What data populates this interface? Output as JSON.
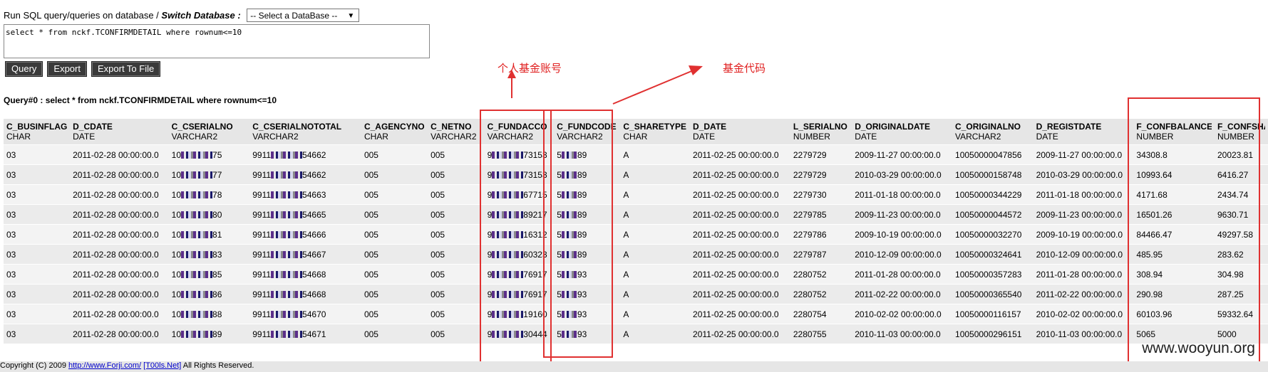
{
  "header": {
    "run_label": "Run SQL query/queries on database /",
    "switch_label": "Switch Database :",
    "db_select_value": "-- Select a DataBase --"
  },
  "sql_text": "select * from nckf.TCONFIRMDETAIL where rownum<=10",
  "buttons": {
    "query": "Query",
    "export": "Export",
    "export_file": "Export To File"
  },
  "query_title": "Query#0 : select * from nckf.TCONFIRMDETAIL where rownum<=10",
  "annotations": {
    "personal_account": "个人基金账号",
    "fund_code": "基金代码"
  },
  "columns": [
    {
      "name": "C_BUSINFLAG",
      "type": "CHAR"
    },
    {
      "name": "D_CDATE",
      "type": "DATE"
    },
    {
      "name": "C_CSERIALNO",
      "type": "VARCHAR2"
    },
    {
      "name": "C_CSERIALNOTOTAL",
      "type": "VARCHAR2"
    },
    {
      "name": "C_AGENCYNO",
      "type": "CHAR"
    },
    {
      "name": "C_NETNO",
      "type": "VARCHAR2"
    },
    {
      "name": "C_FUNDACCO",
      "type": "VARCHAR2"
    },
    {
      "name": "C_FUNDCODE",
      "type": "VARCHAR2"
    },
    {
      "name": "C_SHARETYPE",
      "type": "CHAR"
    },
    {
      "name": "D_DATE",
      "type": "DATE"
    },
    {
      "name": "L_SERIALNO",
      "type": "NUMBER"
    },
    {
      "name": "D_ORIGINALDATE",
      "type": "DATE"
    },
    {
      "name": "C_ORIGINALNO",
      "type": "VARCHAR2"
    },
    {
      "name": "D_REGISTDATE",
      "type": "DATE"
    },
    {
      "name": "F_CONFBALANCE",
      "type": "NUMBER"
    },
    {
      "name": "F_CONFSHAR",
      "type": "NUMBER"
    }
  ],
  "rows": [
    [
      "03",
      "2011-02-28 00:00:00.0",
      "10|75",
      "9911|54662",
      "005",
      "005",
      "9|73153",
      "5|89",
      "A",
      "2011-02-25 00:00:00.0",
      "2279729",
      "2009-11-27 00:00:00.0",
      "10050000047856",
      "2009-11-27 00:00:00.0",
      "34308.8",
      "20023.81"
    ],
    [
      "03",
      "2011-02-28 00:00:00.0",
      "10|77",
      "9911|54662",
      "005",
      "005",
      "9|73153",
      "5|89",
      "A",
      "2011-02-25 00:00:00.0",
      "2279729",
      "2010-03-29 00:00:00.0",
      "10050000158748",
      "2010-03-29 00:00:00.0",
      "10993.64",
      "6416.27"
    ],
    [
      "03",
      "2011-02-28 00:00:00.0",
      "10|78",
      "9911|54663",
      "005",
      "005",
      "9|67715",
      "5|89",
      "A",
      "2011-02-25 00:00:00.0",
      "2279730",
      "2011-01-18 00:00:00.0",
      "10050000344229",
      "2011-01-18 00:00:00.0",
      "4171.68",
      "2434.74"
    ],
    [
      "03",
      "2011-02-28 00:00:00.0",
      "10|80",
      "9911|54665",
      "005",
      "005",
      "9|89217",
      "5|89",
      "A",
      "2011-02-25 00:00:00.0",
      "2279785",
      "2009-11-23 00:00:00.0",
      "10050000044572",
      "2009-11-23 00:00:00.0",
      "16501.26",
      "9630.71"
    ],
    [
      "03",
      "2011-02-28 00:00:00.0",
      "10|81",
      "9911|54666",
      "005",
      "005",
      "9|16312",
      "5|89",
      "A",
      "2011-02-25 00:00:00.0",
      "2279786",
      "2009-10-19 00:00:00.0",
      "10050000032270",
      "2009-10-19 00:00:00.0",
      "84466.47",
      "49297.58"
    ],
    [
      "03",
      "2011-02-28 00:00:00.0",
      "10|83",
      "9911|54667",
      "005",
      "005",
      "9|60323",
      "5|89",
      "A",
      "2011-02-25 00:00:00.0",
      "2279787",
      "2010-12-09 00:00:00.0",
      "10050000324641",
      "2010-12-09 00:00:00.0",
      "485.95",
      "283.62"
    ],
    [
      "03",
      "2011-02-28 00:00:00.0",
      "10|85",
      "9911|54668",
      "005",
      "005",
      "9|76917",
      "5|93",
      "A",
      "2011-02-25 00:00:00.0",
      "2280752",
      "2011-01-28 00:00:00.0",
      "10050000357283",
      "2011-01-28 00:00:00.0",
      "308.94",
      "304.98"
    ],
    [
      "03",
      "2011-02-28 00:00:00.0",
      "10|86",
      "9911|54668",
      "005",
      "005",
      "9|76917",
      "5|93",
      "A",
      "2011-02-25 00:00:00.0",
      "2280752",
      "2011-02-22 00:00:00.0",
      "10050000365540",
      "2011-02-22 00:00:00.0",
      "290.98",
      "287.25"
    ],
    [
      "03",
      "2011-02-28 00:00:00.0",
      "10|88",
      "9911|54670",
      "005",
      "005",
      "9|19160",
      "5|93",
      "A",
      "2011-02-25 00:00:00.0",
      "2280754",
      "2010-02-02 00:00:00.0",
      "10050000116157",
      "2010-02-02 00:00:00.0",
      "60103.96",
      "59332.64"
    ],
    [
      "03",
      "2011-02-28 00:00:00.0",
      "10|89",
      "9911|54671",
      "005",
      "005",
      "9|30444",
      "5|93",
      "A",
      "2011-02-25 00:00:00.0",
      "2280755",
      "2010-11-03 00:00:00.0",
      "10050000296151",
      "2010-11-03 00:00:00.0",
      "5065",
      "5000"
    ]
  ],
  "footer": {
    "prefix": "Copyright (C) 2009",
    "link1": "http://www.Forji.com/",
    "link2": "[T00ls.Net]",
    "suffix": "All Rights Reserved."
  },
  "watermark": "www.wooyun.org"
}
